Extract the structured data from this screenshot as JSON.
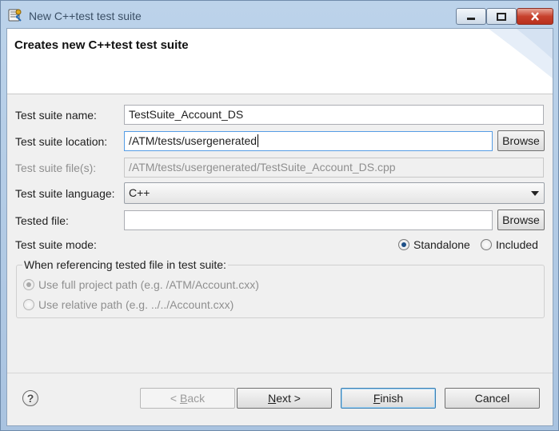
{
  "window": {
    "title": "New C++test test suite",
    "accent": "#bcd3ea"
  },
  "banner": {
    "title": "Creates new C++test test suite"
  },
  "form": {
    "name_label": "Test suite name:",
    "name_value": "TestSuite_Account_DS",
    "location_label": "Test suite location:",
    "location_value": "/ATM/tests/usergenerated",
    "browse_label": "Browse",
    "file_label": "Test suite file(s):",
    "file_value": "/ATM/tests/usergenerated/TestSuite_Account_DS.cpp",
    "language_label": "Test suite language:",
    "language_value": "C++",
    "tested_label": "Tested file:",
    "tested_value": "",
    "mode_label": "Test suite mode:",
    "mode_standalone": "Standalone",
    "mode_included": "Included",
    "group_legend": "When referencing tested file in test suite:",
    "opt_full": "Use full project path (e.g. /ATM/Account.cxx)",
    "opt_relative": "Use relative path (e.g. ../../Account.cxx)"
  },
  "footer": {
    "help": "?",
    "back_prefix": "< ",
    "back_key": "B",
    "back_rest": "ack",
    "next_key": "N",
    "next_rest": "ext >",
    "finish_key": "F",
    "finish_rest": "inish",
    "cancel_label": "Cancel"
  }
}
